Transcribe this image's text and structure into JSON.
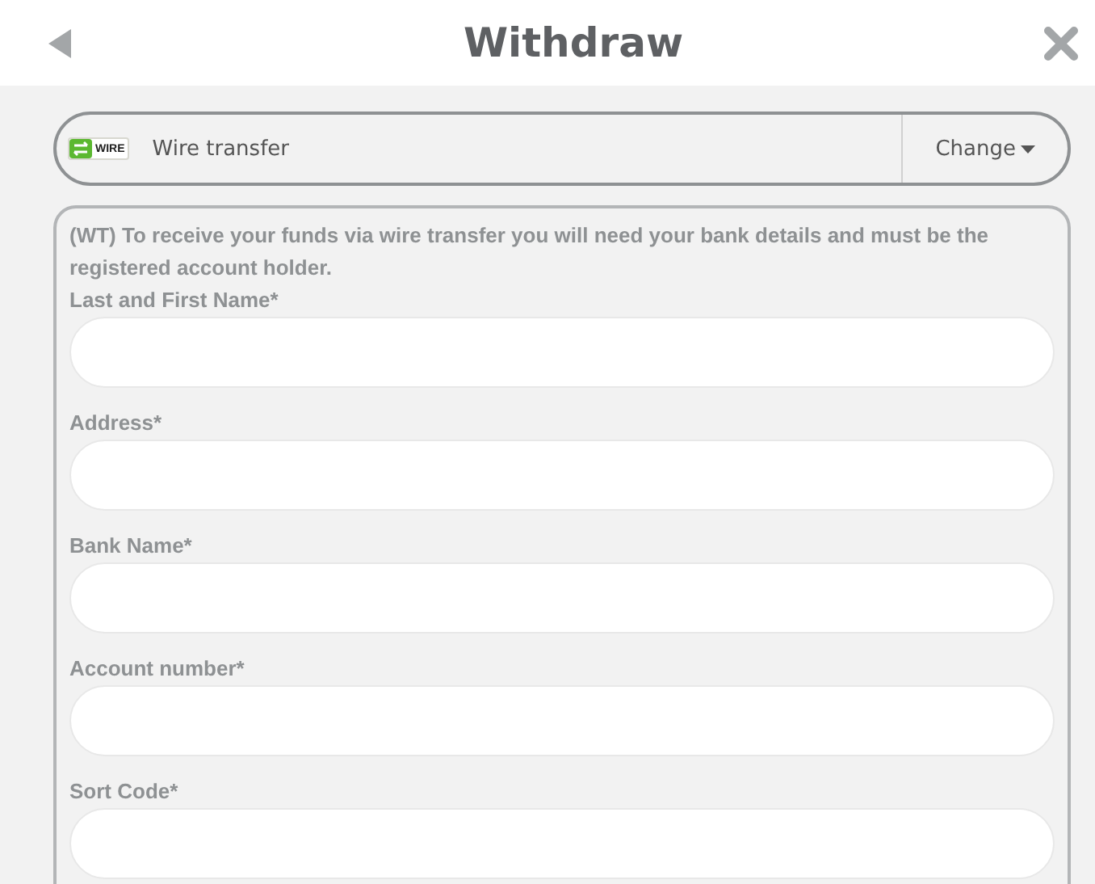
{
  "header": {
    "title": "Withdraw"
  },
  "method": {
    "logo_text": "WIRE",
    "name": "Wire transfer",
    "change": "Change"
  },
  "form": {
    "description": "(WT) To receive your funds via wire transfer you will need your bank details and must be the registered account holder.",
    "fields": [
      {
        "label": "Last and First Name*"
      },
      {
        "label": "Address*"
      },
      {
        "label": "Bank Name*"
      },
      {
        "label": "Account number*"
      },
      {
        "label": "Sort Code*"
      }
    ]
  }
}
